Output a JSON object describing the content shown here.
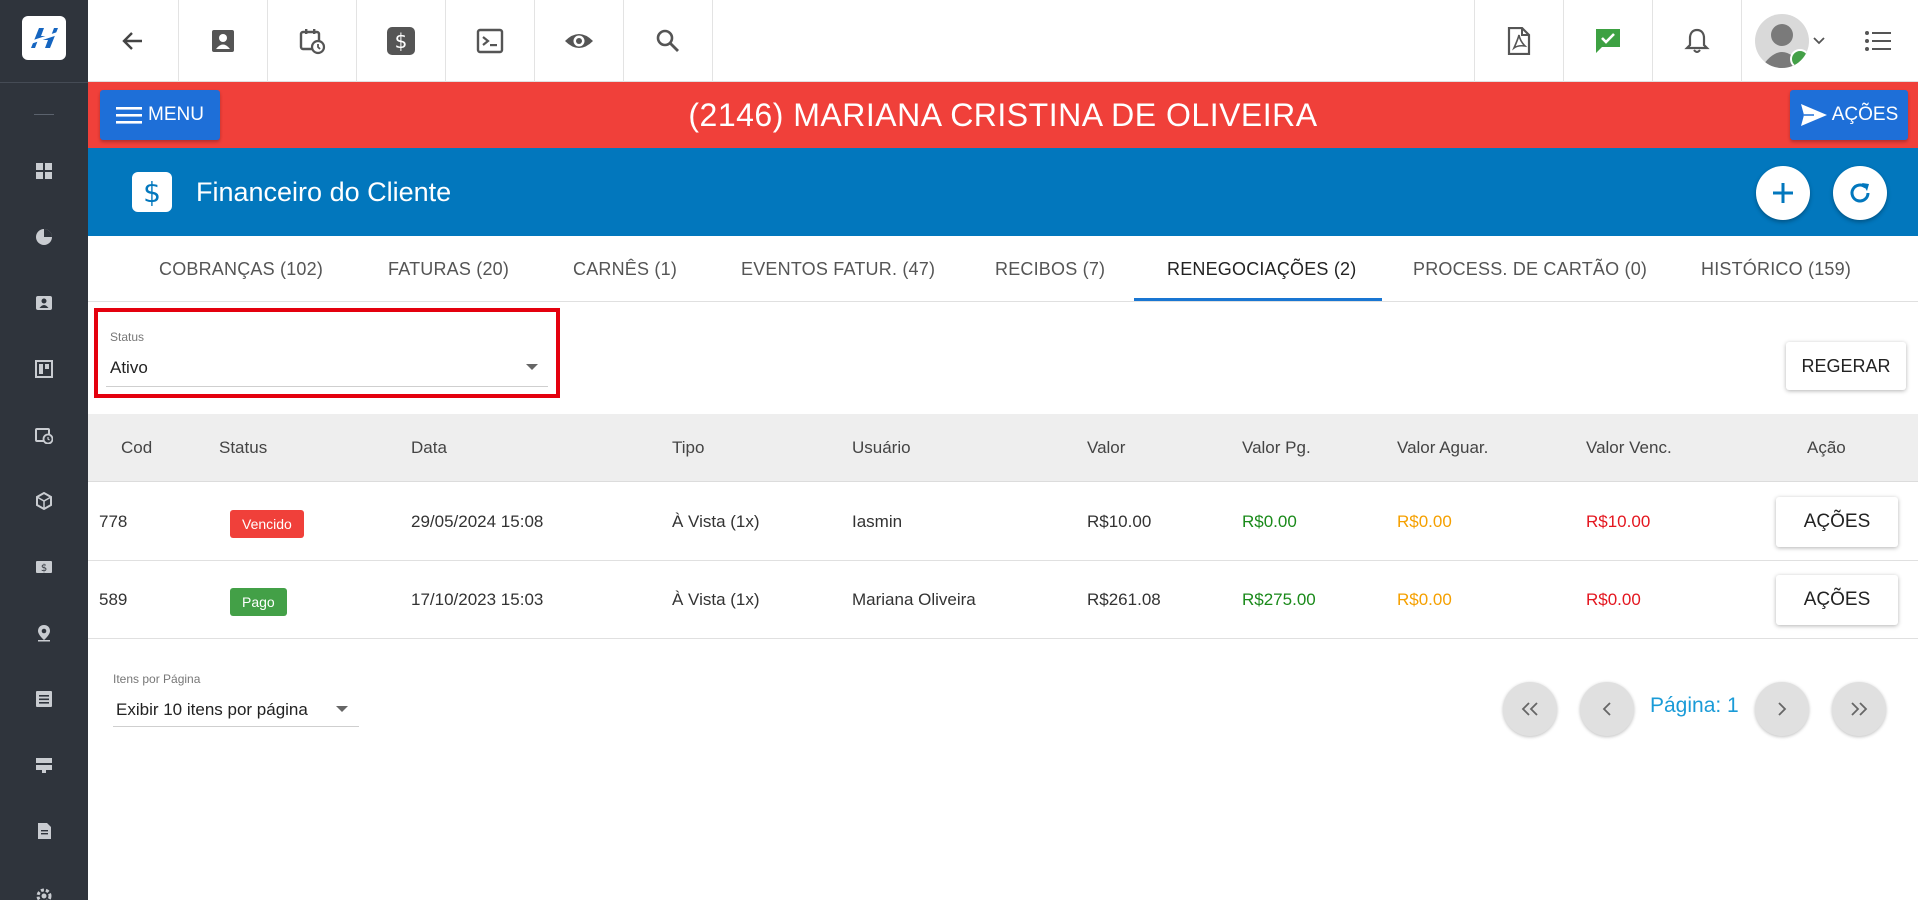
{
  "sidebar": {
    "logo": "logo-mark",
    "items": [
      "dashboard-icon",
      "chart-pie-icon",
      "contact-card-icon",
      "board-icon",
      "calendar-clock-icon",
      "box-icon",
      "money-icon",
      "location-pin-icon",
      "list-icon",
      "server-icon",
      "document-icon",
      "gear-icon"
    ]
  },
  "topbar": {
    "buttons": [
      "back-arrow-icon",
      "contact-card-icon",
      "calendar-clock-icon",
      "dollar-icon",
      "terminal-icon",
      "eye-icon",
      "search-icon"
    ],
    "right_buttons": [
      "pdf-icon",
      "check-chat-icon",
      "bell-icon",
      "avatar",
      "list-menu-icon"
    ]
  },
  "banner": {
    "menu_label": "MENU",
    "title": "(2146) MARIANA CRISTINA DE OLIVEIRA",
    "actions_label": "AÇÕES",
    "color": "#f0403a"
  },
  "header": {
    "title": "Financeiro do Cliente",
    "color": "#0277bd"
  },
  "tabs": [
    {
      "label": "COBRANÇAS (102)"
    },
    {
      "label": "FATURAS (20)"
    },
    {
      "label": "CARNÊS (1)"
    },
    {
      "label": "EVENTOS FATUR. (47)"
    },
    {
      "label": "RECIBOS (7)"
    },
    {
      "label": "RENEGOCIAÇÕES (2)"
    },
    {
      "label": "PROCESS. DE CARTÃO (0)"
    },
    {
      "label": "HISTÓRICO (159)"
    }
  ],
  "filter": {
    "label": "Status",
    "value": "Ativo",
    "regerar_label": "REGERAR"
  },
  "table": {
    "columns": [
      "Cod",
      "Status",
      "Data",
      "Tipo",
      "Usuário",
      "Valor",
      "Valor Pg.",
      "Valor Aguar.",
      "Valor Venc.",
      "Ação"
    ],
    "rows": [
      {
        "cod": "778",
        "status": "Vencido",
        "status_color": "#f0403a",
        "data": "29/05/2024 15:08",
        "tipo": "À Vista (1x)",
        "usuario": "Iasmin",
        "valor": "R$10.00",
        "valor_pg": "R$0.00",
        "valor_aguar": "R$0.00",
        "valor_venc": "R$10.00",
        "acao": "AÇÕES"
      },
      {
        "cod": "589",
        "status": "Pago",
        "status_color": "#43a047",
        "data": "17/10/2023 15:03",
        "tipo": "À Vista (1x)",
        "usuario": "Mariana Oliveira",
        "valor": "R$261.08",
        "valor_pg": "R$275.00",
        "valor_aguar": "R$0.00",
        "valor_venc": "R$0.00",
        "acao": "AÇÕES"
      }
    ]
  },
  "pagination": {
    "items_label": "Itens por Página",
    "items_value": "Exibir 10 itens por página",
    "page_label": "Página: 1"
  }
}
